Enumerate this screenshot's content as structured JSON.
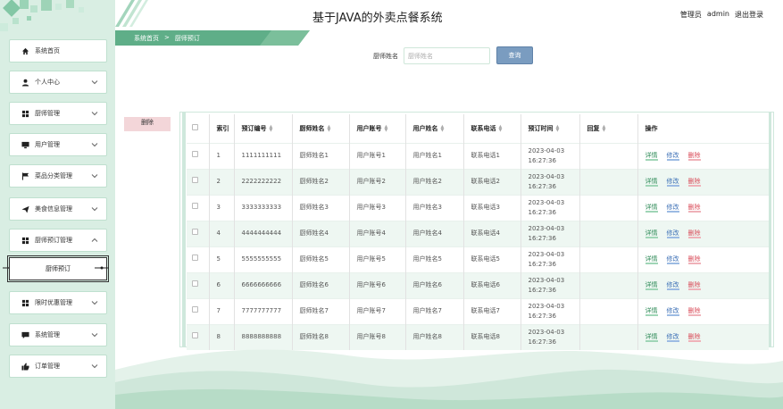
{
  "header": {
    "title": "基于JAVA的外卖点餐系统",
    "user_role": "管理员",
    "username": "admin",
    "logout": "退出登录"
  },
  "breadcrumb": {
    "home": "系统首页",
    "separator": ">",
    "current": "厨师预订"
  },
  "sidebar": {
    "items": [
      {
        "label": "系统首页",
        "icon": "home-icon"
      },
      {
        "label": "个人中心",
        "icon": "user-icon"
      },
      {
        "label": "厨师管理",
        "icon": "grid-icon"
      },
      {
        "label": "用户管理",
        "icon": "monitor-icon"
      },
      {
        "label": "菜品分类管理",
        "icon": "flag-icon"
      },
      {
        "label": "美食信息管理",
        "icon": "send-icon"
      },
      {
        "label": "厨师预订管理",
        "icon": "grid-icon"
      },
      {
        "label": "限时优惠管理",
        "icon": "grid-icon"
      },
      {
        "label": "系统管理",
        "icon": "chat-icon"
      },
      {
        "label": "订单管理",
        "icon": "thumb-icon"
      }
    ],
    "submenu": {
      "label": "厨师预订"
    }
  },
  "search": {
    "label": "厨师姓名",
    "placeholder": "厨师姓名",
    "button": "查询"
  },
  "actions": {
    "delete": "删除"
  },
  "table": {
    "headers": {
      "index": "索引",
      "order_no": "预订编号",
      "chef_name": "厨师姓名",
      "account": "用户账号",
      "user_name": "用户姓名",
      "phone": "联系电话",
      "time": "预订时间",
      "reply": "回复",
      "ops": "操作"
    },
    "ops": {
      "detail": "详情",
      "edit": "修改",
      "delete": "删除"
    },
    "rows": [
      {
        "index": "1",
        "order_no": "1111111111",
        "chef_name": "厨师姓名1",
        "account": "用户账号1",
        "user_name": "用户姓名1",
        "phone": "联系电话1",
        "date": "2023-04-03",
        "time": "16:27:36",
        "reply": ""
      },
      {
        "index": "2",
        "order_no": "2222222222",
        "chef_name": "厨师姓名2",
        "account": "用户账号2",
        "user_name": "用户姓名2",
        "phone": "联系电话2",
        "date": "2023-04-03",
        "time": "16:27:36",
        "reply": ""
      },
      {
        "index": "3",
        "order_no": "3333333333",
        "chef_name": "厨师姓名3",
        "account": "用户账号3",
        "user_name": "用户姓名3",
        "phone": "联系电话3",
        "date": "2023-04-03",
        "time": "16:27:36",
        "reply": ""
      },
      {
        "index": "4",
        "order_no": "4444444444",
        "chef_name": "厨师姓名4",
        "account": "用户账号4",
        "user_name": "用户姓名4",
        "phone": "联系电话4",
        "date": "2023-04-03",
        "time": "16:27:36",
        "reply": ""
      },
      {
        "index": "5",
        "order_no": "5555555555",
        "chef_name": "厨师姓名5",
        "account": "用户账号5",
        "user_name": "用户姓名5",
        "phone": "联系电话5",
        "date": "2023-04-03",
        "time": "16:27:36",
        "reply": ""
      },
      {
        "index": "6",
        "order_no": "6666666666",
        "chef_name": "厨师姓名6",
        "account": "用户账号6",
        "user_name": "用户姓名6",
        "phone": "联系电话6",
        "date": "2023-04-03",
        "time": "16:27:36",
        "reply": ""
      },
      {
        "index": "7",
        "order_no": "7777777777",
        "chef_name": "厨师姓名7",
        "account": "用户账号7",
        "user_name": "用户姓名7",
        "phone": "联系电话7",
        "date": "2023-04-03",
        "time": "16:27:36",
        "reply": ""
      },
      {
        "index": "8",
        "order_no": "8888888888",
        "chef_name": "厨师姓名8",
        "account": "用户账号8",
        "user_name": "用户姓名8",
        "phone": "联系电话8",
        "date": "2023-04-03",
        "time": "16:27:36",
        "reply": ""
      }
    ]
  },
  "colors": {
    "sidebar_bg": "#d9eee3",
    "accent_green": "#5fae88",
    "search_button": "#7a9cc0",
    "delete_button_bg": "#f3d6d9"
  }
}
